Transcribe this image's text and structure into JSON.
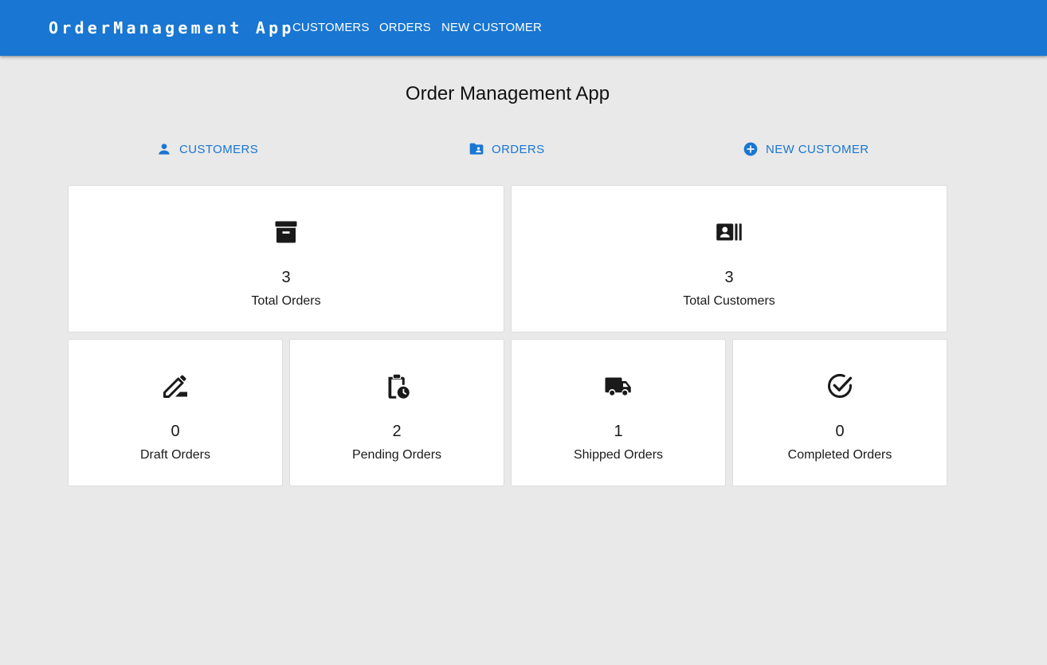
{
  "appbar": {
    "brand": "OrderManagement App",
    "nav": [
      "CUSTOMERS",
      "ORDERS",
      "NEW CUSTOMER"
    ]
  },
  "page": {
    "title": "Order Management App"
  },
  "quick_links": [
    {
      "label": "CUSTOMERS",
      "icon": "person-icon"
    },
    {
      "label": "ORDERS",
      "icon": "folder-shared-icon"
    },
    {
      "label": "NEW CUSTOMER",
      "icon": "add-circle-icon"
    }
  ],
  "stats": {
    "total_orders": {
      "value": "3",
      "label": "Total Orders",
      "icon": "archive-box-icon"
    },
    "total_customers": {
      "value": "3",
      "label": "Total Customers",
      "icon": "contact-card-icon"
    },
    "draft_orders": {
      "value": "0",
      "label": "Draft Orders",
      "icon": "edit-pen-icon"
    },
    "pending_orders": {
      "value": "2",
      "label": "Pending Orders",
      "icon": "clipboard-clock-icon"
    },
    "shipped_orders": {
      "value": "1",
      "label": "Shipped Orders",
      "icon": "truck-icon"
    },
    "completed_orders": {
      "value": "0",
      "label": "Completed Orders",
      "icon": "check-circle-icon"
    }
  },
  "colors": {
    "primary": "#1976d2",
    "background": "#e9e9e9",
    "card": "#ffffff",
    "icon": "#1a1a1a"
  }
}
